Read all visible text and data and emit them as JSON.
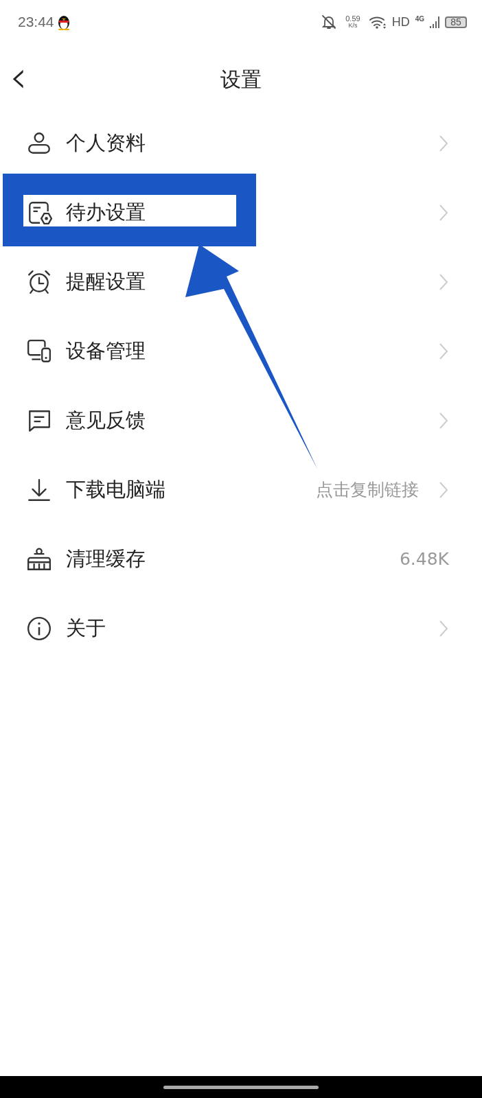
{
  "status_bar": {
    "time": "23:44",
    "speed_value": "0.59",
    "speed_unit": "K/s",
    "hd": "HD",
    "network": "4G",
    "battery": "85"
  },
  "header": {
    "back": "‹",
    "title": "设置"
  },
  "rows": [
    {
      "label": "个人资料",
      "has_arrow": true
    },
    {
      "label": "待办设置",
      "has_arrow": true
    },
    {
      "label": "提醒设置",
      "has_arrow": true
    },
    {
      "label": "设备管理",
      "has_arrow": true
    },
    {
      "label": "意见反馈",
      "has_arrow": true
    },
    {
      "label": "下载电脑端",
      "value": "点击复制链接",
      "has_arrow": true
    },
    {
      "label": "清理缓存",
      "value": "6.48K",
      "has_arrow": false
    },
    {
      "label": "关于",
      "has_arrow": true
    }
  ]
}
